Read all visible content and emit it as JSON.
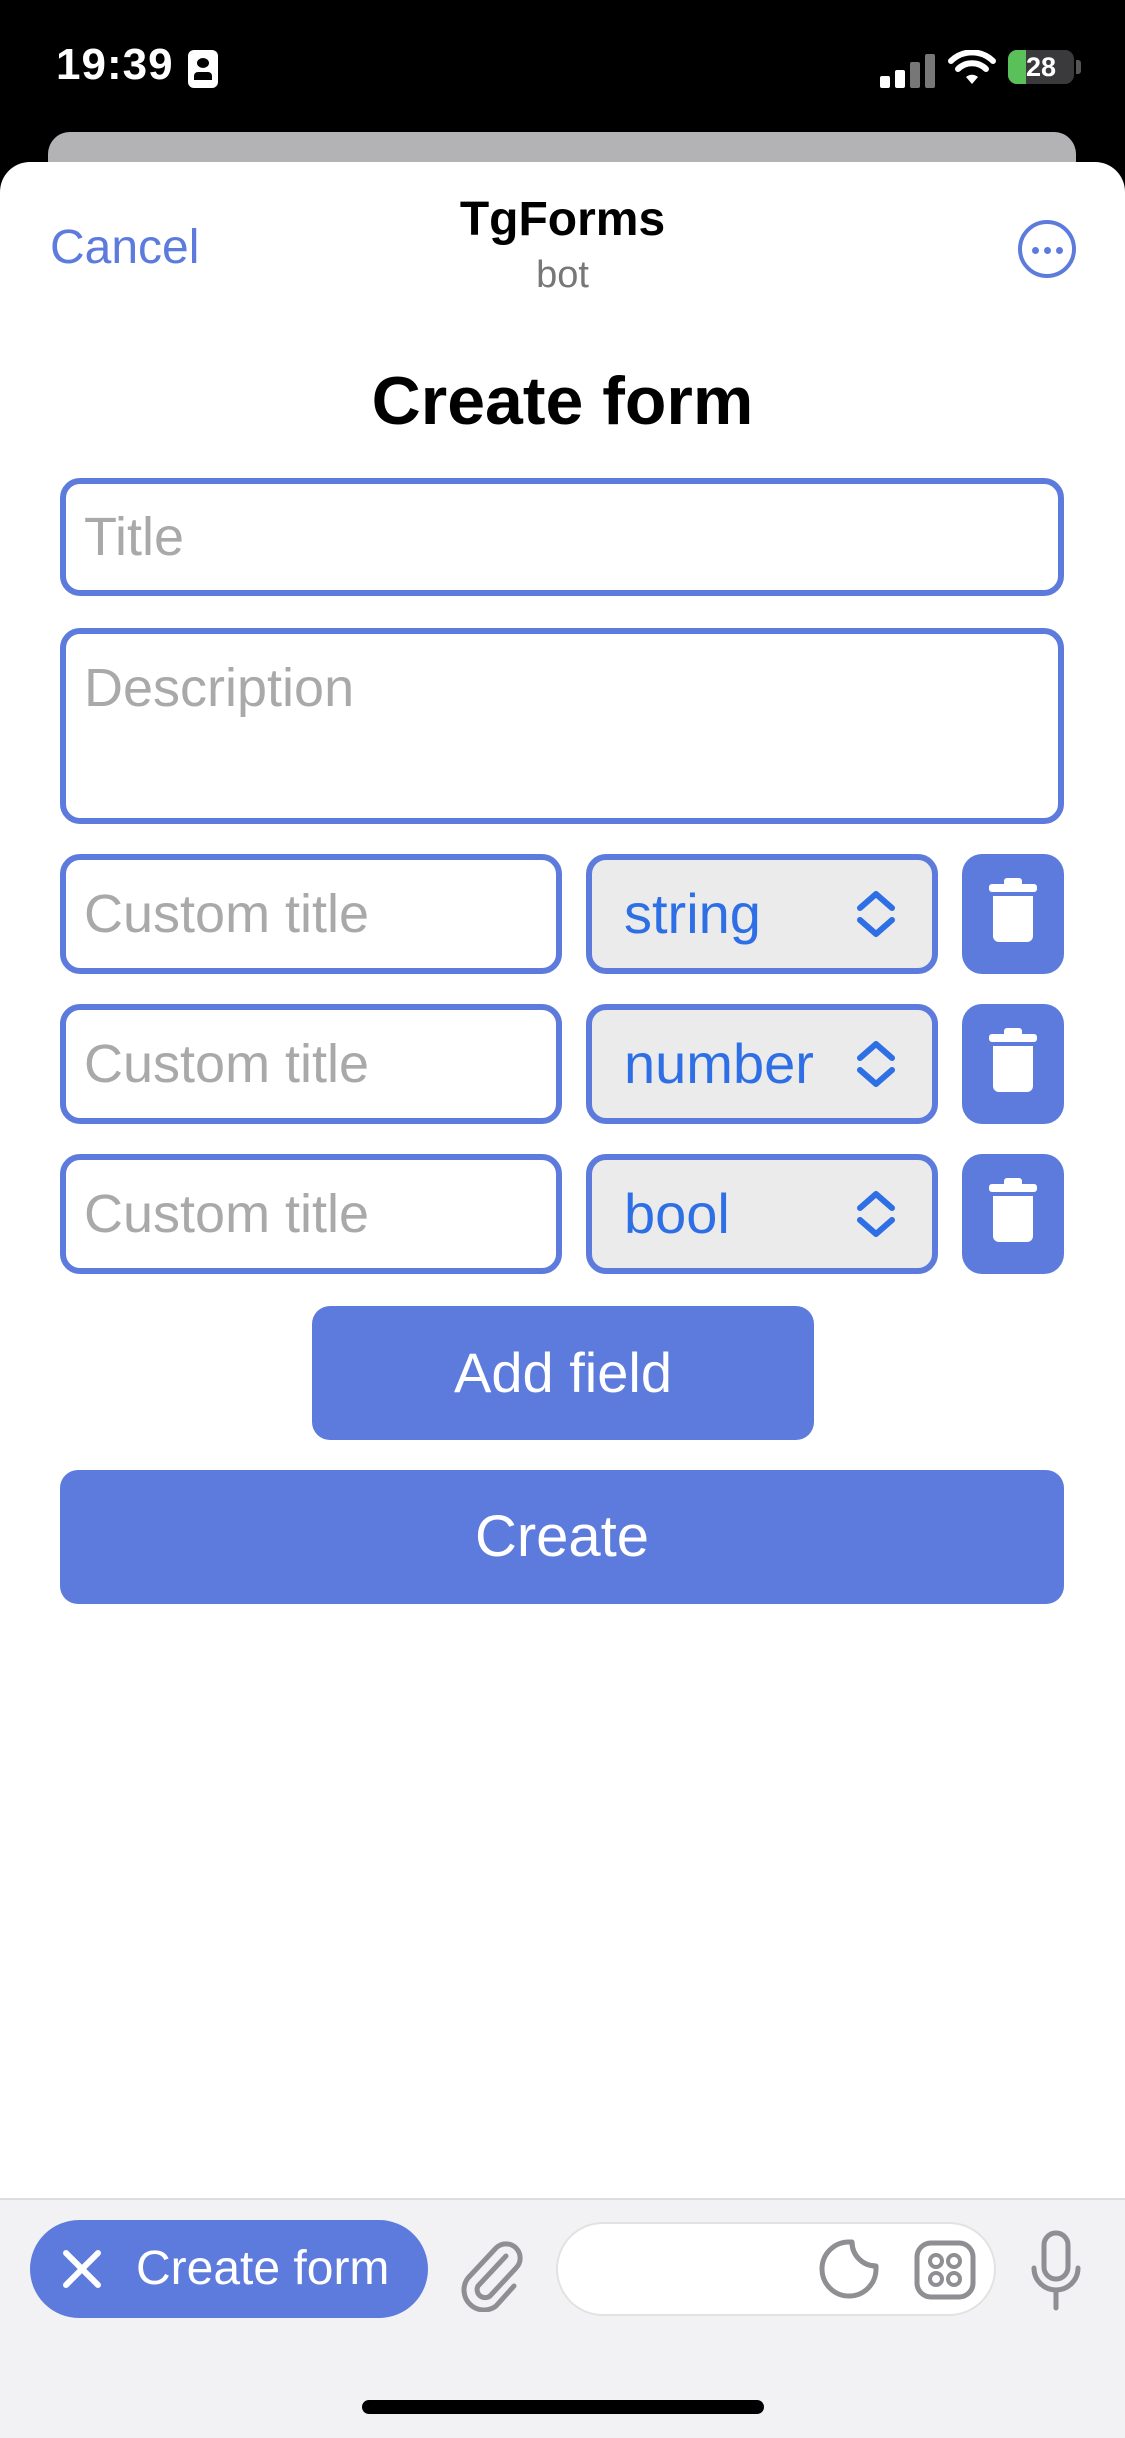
{
  "status_bar": {
    "time": "19:39",
    "battery": "28",
    "battery_level": 0.28,
    "icons": [
      "contact-card-icon",
      "cellular-signal-icon",
      "wifi-icon",
      "battery-charging-icon"
    ]
  },
  "header": {
    "cancel_label": "Cancel",
    "title": "TgForms",
    "subtitle": "bot",
    "more_icon": "more-ellipsis-icon"
  },
  "form": {
    "heading": "Create form",
    "title_placeholder": "Title",
    "description_placeholder": "Description",
    "fields": [
      {
        "placeholder": "Custom title",
        "type": "string"
      },
      {
        "placeholder": "Custom title",
        "type": "number"
      },
      {
        "placeholder": "Custom title",
        "type": "bool"
      }
    ],
    "delete_icon": "trash-icon",
    "add_field_label": "Add field",
    "create_label": "Create"
  },
  "bottom_bar": {
    "chip_label": "Create form",
    "chip_icon": "close-icon",
    "attach_icon": "paperclip-icon",
    "sticker_icon": "sticker-icon",
    "apps_icon": "apps-grid-icon",
    "mic_icon": "microphone-icon"
  },
  "colors": {
    "accent": "#5d7bdc",
    "select_text": "#2f6fe6",
    "placeholder": "#a9a9a9",
    "select_bg": "#ebebeb"
  }
}
